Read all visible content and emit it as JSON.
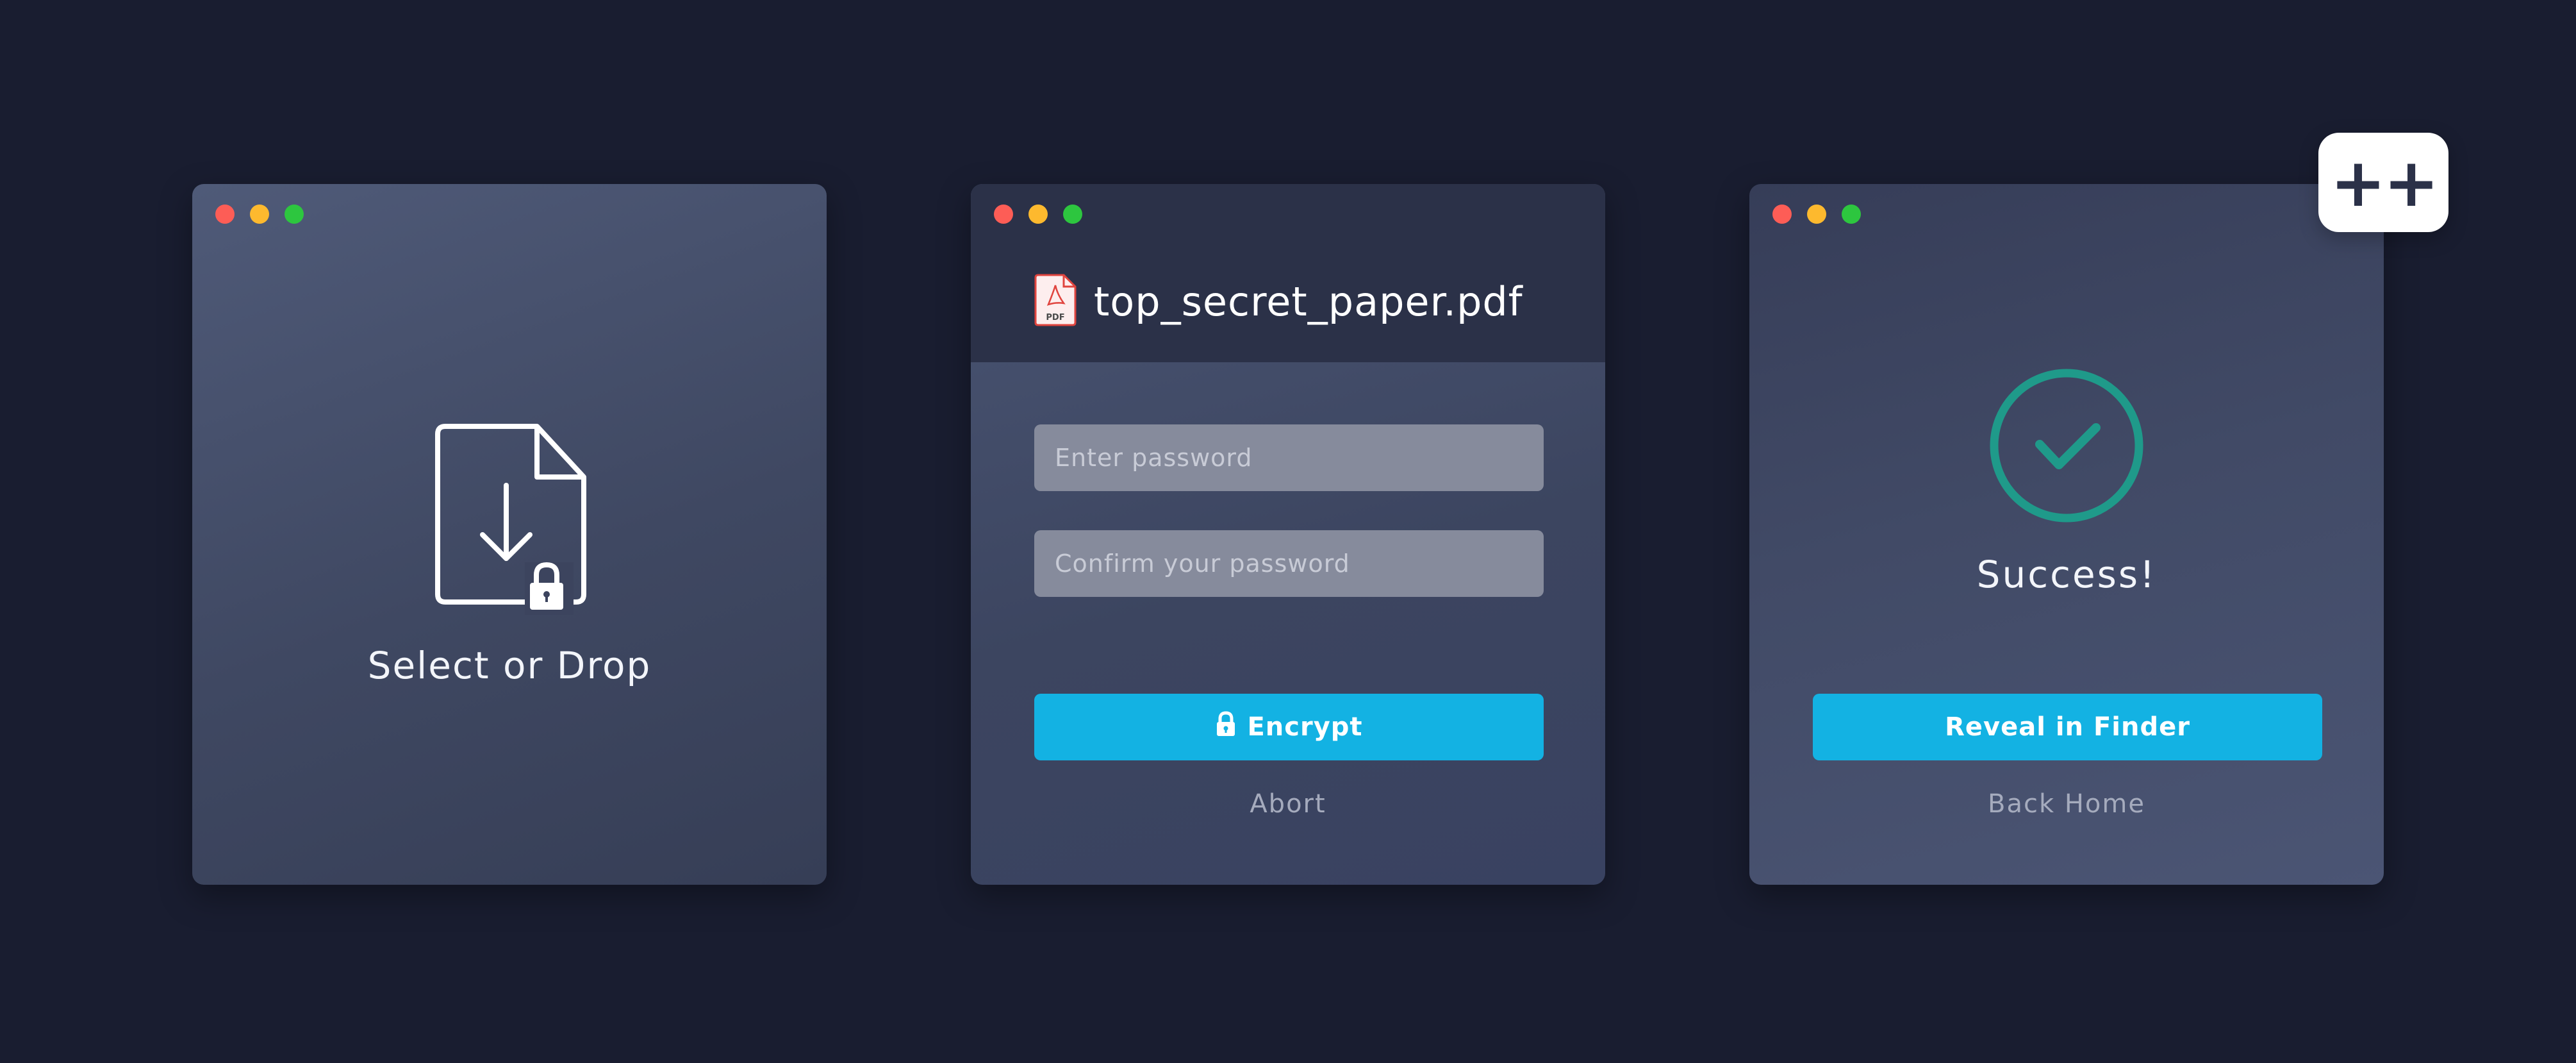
{
  "drop_window": {
    "label": "Select or Drop",
    "icon": "file-download-lock-icon"
  },
  "encrypt_window": {
    "file_name": "top_secret_paper.pdf",
    "file_icon": "pdf-file-icon",
    "password": {
      "value": "",
      "placeholder": "Enter password"
    },
    "confirm_password": {
      "value": "",
      "placeholder": "Confirm your password"
    },
    "encrypt_label": "Encrypt",
    "abort_label": "Abort"
  },
  "success_window": {
    "status": "Success!",
    "icon": "checkmark-circle-icon",
    "reveal_label": "Reveal in Finder",
    "back_label": "Back Home"
  },
  "badge": {
    "label": "++"
  },
  "colors": {
    "background": "#191d30",
    "accent": "#13b2e3",
    "success": "#1f9a8a",
    "traffic_red": "#fd5d56",
    "traffic_yellow": "#fdb92e",
    "traffic_green": "#2dc63f"
  }
}
